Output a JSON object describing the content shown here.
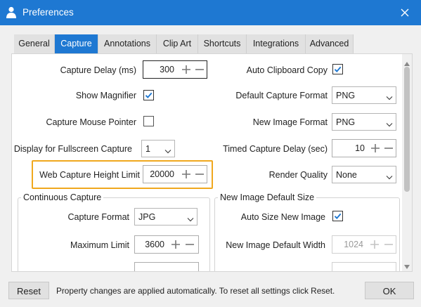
{
  "window": {
    "title": "Preferences"
  },
  "tabs": [
    {
      "label": "General",
      "active": false
    },
    {
      "label": "Capture",
      "active": true
    },
    {
      "label": "Annotations",
      "active": false
    },
    {
      "label": "Clip Art",
      "active": false
    },
    {
      "label": "Shortcuts",
      "active": false
    },
    {
      "label": "Integrations",
      "active": false
    },
    {
      "label": "Advanced",
      "active": false
    }
  ],
  "capture": {
    "capture_delay": {
      "label": "Capture Delay (ms)",
      "value": "300"
    },
    "show_magnifier": {
      "label": "Show Magnifier",
      "checked": true
    },
    "capture_mouse_pointer": {
      "label": "Capture Mouse Pointer",
      "checked": false
    },
    "display_fullscreen": {
      "label": "Display for Fullscreen Capture",
      "value": "1"
    },
    "web_capture_height_limit": {
      "label": "Web Capture Height Limit",
      "value": "20000"
    },
    "auto_clipboard_copy": {
      "label": "Auto Clipboard Copy",
      "checked": true
    },
    "default_capture_format": {
      "label": "Default Capture Format",
      "value": "PNG"
    },
    "new_image_format": {
      "label": "New Image Format",
      "value": "PNG"
    },
    "timed_capture_delay": {
      "label": "Timed Capture Delay (sec)",
      "value": "10"
    },
    "render_quality": {
      "label": "Render Quality",
      "value": "None"
    }
  },
  "continuous_capture": {
    "title": "Continuous Capture",
    "capture_format": {
      "label": "Capture Format",
      "value": "JPG"
    },
    "maximum_limit": {
      "label": "Maximum Limit",
      "value": "3600"
    }
  },
  "new_image_default_size": {
    "title": "New Image Default Size",
    "auto_size": {
      "label": "Auto Size New Image",
      "checked": true
    },
    "default_width": {
      "label": "New Image Default Width",
      "value": "1024"
    }
  },
  "footer": {
    "reset_label": "Reset",
    "message": "Property changes are applied automatically. To reset all settings click Reset.",
    "ok_label": "OK"
  },
  "colors": {
    "accent": "#1e78d2",
    "highlight": "#f0a81e"
  }
}
